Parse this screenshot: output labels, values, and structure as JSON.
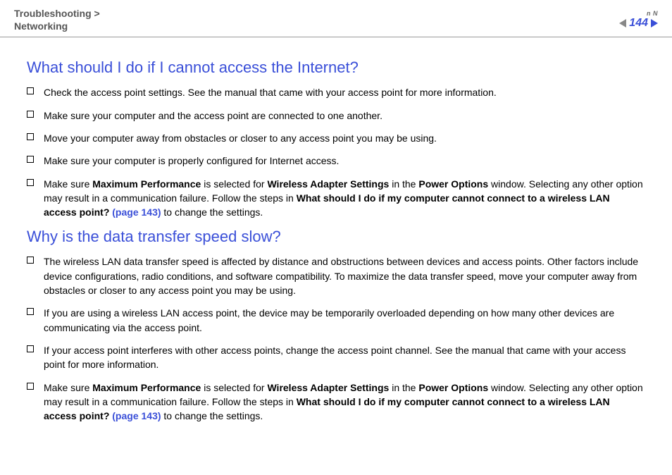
{
  "breadcrumb_line1": "Troubleshooting >",
  "breadcrumb_line2": "Networking",
  "page_number": "144",
  "n_label": "n N",
  "section1": {
    "heading": "What should I do if I cannot access the Internet?",
    "items": [
      {
        "plain": "Check the access point settings. See the manual that came with your access point for more information."
      },
      {
        "plain": "Make sure your computer and the access point are connected to one another."
      },
      {
        "plain": "Move your computer away from obstacles or closer to any access point you may be using."
      },
      {
        "plain": "Make sure your computer is properly configured for Internet access."
      },
      {
        "pre": "Make sure ",
        "b1": "Maximum Performance",
        "mid1": " is selected for ",
        "b2": "Wireless Adapter Settings",
        "mid2": " in the ",
        "b3": "Power Options",
        "mid3": " window. Selecting any other option may result in a communication failure. Follow the steps in ",
        "b4": "What should I do if my computer cannot connect to a wireless LAN access point? ",
        "link": "(page 143)",
        "post": " to change the settings."
      }
    ]
  },
  "section2": {
    "heading": "Why is the data transfer speed slow?",
    "items": [
      {
        "plain": "The wireless LAN data transfer speed is affected by distance and obstructions between devices and access points. Other factors include device configurations, radio conditions, and software compatibility. To maximize the data transfer speed, move your computer away from obstacles or closer to any access point you may be using."
      },
      {
        "plain": "If you are using a wireless LAN access point, the device may be temporarily overloaded depending on how many other devices are communicating via the access point."
      },
      {
        "plain": "If your access point interferes with other access points, change the access point channel. See the manual that came with your access point for more information."
      },
      {
        "pre": "Make sure ",
        "b1": "Maximum Performance",
        "mid1": " is selected for ",
        "b2": "Wireless Adapter Settings",
        "mid2": " in the ",
        "b3": "Power Options",
        "mid3": " window. Selecting any other option may result in a communication failure. Follow the steps in ",
        "b4": "What should I do if my computer cannot connect to a wireless LAN access point? ",
        "link": "(page 143)",
        "post": " to change the settings."
      }
    ]
  }
}
